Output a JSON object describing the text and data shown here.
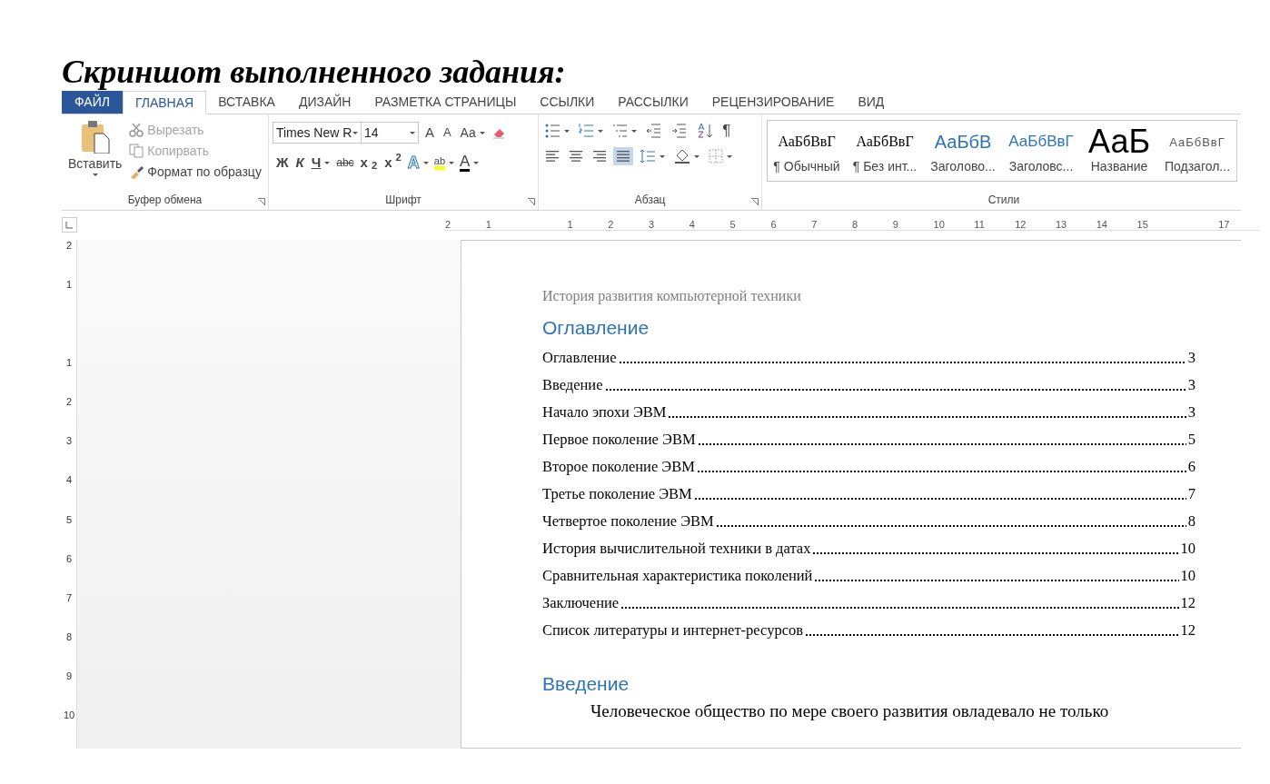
{
  "heading": "Скриншот выполненного задания:",
  "tabs": [
    {
      "label": "ФАЙЛ",
      "kind": "file",
      "selected": false
    },
    {
      "label": "ГЛАВНАЯ",
      "kind": "tab",
      "selected": true
    },
    {
      "label": "ВСТАВКА",
      "kind": "tab",
      "selected": false
    },
    {
      "label": "ДИЗАЙН",
      "kind": "tab",
      "selected": false
    },
    {
      "label": "РАЗМЕТКА СТРАНИЦЫ",
      "kind": "tab",
      "selected": false
    },
    {
      "label": "ССЫЛКИ",
      "kind": "tab",
      "selected": false
    },
    {
      "label": "РАССЫЛКИ",
      "kind": "tab",
      "selected": false
    },
    {
      "label": "РЕЦЕНЗИРОВАНИЕ",
      "kind": "tab",
      "selected": false
    },
    {
      "label": "ВИД",
      "kind": "tab",
      "selected": false
    }
  ],
  "clipboard": {
    "paste": "Вставить",
    "cut": {
      "label": "Вырезать",
      "disabled": true
    },
    "copy": {
      "label": "Копирвать",
      "disabled": true
    },
    "painter": {
      "label": "Формат по образцу",
      "disabled": false
    },
    "group_label": "Буфер обмена"
  },
  "font": {
    "name": "Times New R",
    "size": "14",
    "grow": "A",
    "shrink": "A",
    "case": "Aa",
    "bold": "Ж",
    "italic": "К",
    "underline": "Ч",
    "strike": "abc",
    "subscript": "x$_{2}$",
    "superscript": "x$^{2}$",
    "effects": "A",
    "highlight": "ab",
    "font_color_letter": "A",
    "group_label": "Шрифт"
  },
  "paragraph": {
    "pilcrow": "¶",
    "align": [
      {
        "kind": "left",
        "selected": false
      },
      {
        "kind": "center",
        "selected": false
      },
      {
        "kind": "right",
        "selected": false
      },
      {
        "kind": "justify",
        "selected": true
      }
    ],
    "group_label": "Абзац"
  },
  "styles": {
    "items": [
      {
        "preview": "АаБбВвГ",
        "label": "¶ Обычный",
        "kind": "normal"
      },
      {
        "preview": "АаБбВвГ",
        "label": "¶ Без инт...",
        "kind": "nospacing"
      },
      {
        "preview": "АаБбВ",
        "label": "Заголово...",
        "kind": "heading1"
      },
      {
        "preview": "АаБбВвГ",
        "label": "Заголовс...",
        "kind": "heading2"
      },
      {
        "preview": "АаБ",
        "label": "Название",
        "kind": "title"
      },
      {
        "preview": "АаБбВвГ",
        "label": "Подзагол...",
        "kind": "subtitle"
      }
    ],
    "group_label": "Стили"
  },
  "ruler": {
    "horizontal": [
      "2",
      "1",
      "1",
      "2",
      "3",
      "4",
      "5",
      "6",
      "7",
      "8",
      "9",
      "10",
      "11",
      "12",
      "13",
      "14",
      "15",
      "17"
    ],
    "vertical": [
      "2",
      "1",
      "1",
      "2",
      "3",
      "4",
      "5",
      "6",
      "7",
      "8",
      "9",
      "10"
    ]
  },
  "document": {
    "header": "История развития компьютерной техники",
    "toc_title": "Оглавление",
    "toc": [
      {
        "title": "Оглавление",
        "page": "3"
      },
      {
        "title": "Введение",
        "page": "3"
      },
      {
        "title": "Начало эпохи ЭВМ",
        "page": "3"
      },
      {
        "title": "Первое поколение ЭВМ",
        "page": "5"
      },
      {
        "title": "Второе поколение ЭВМ",
        "page": "6"
      },
      {
        "title": "Третье поколение ЭВМ",
        "page": "7"
      },
      {
        "title": "Четвертое поколение ЭВМ",
        "page": "8"
      },
      {
        "title": "История вычислительной техники в датах",
        "page": "10"
      },
      {
        "title": "Сравнительная характеристика поколений",
        "page": "10"
      },
      {
        "title": "Заключение",
        "page": "12"
      },
      {
        "title": "Список литературы и интернет-ресурсов",
        "page": "12"
      }
    ],
    "section_title": "Введение",
    "paragraph": "Человеческое общество по мере своего развития овладевало не только"
  }
}
